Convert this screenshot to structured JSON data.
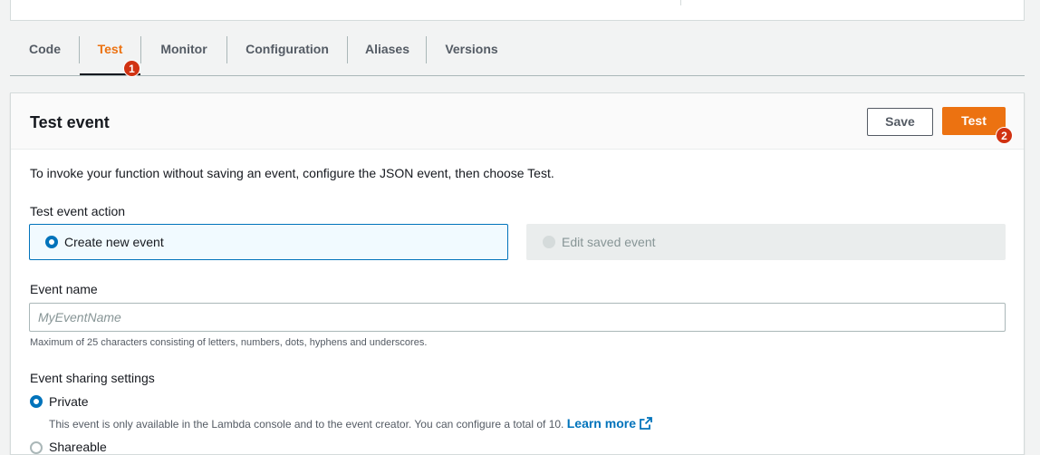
{
  "tabs": [
    {
      "label": "Code",
      "active": false
    },
    {
      "label": "Test",
      "active": true
    },
    {
      "label": "Monitor",
      "active": false
    },
    {
      "label": "Configuration",
      "active": false
    },
    {
      "label": "Aliases",
      "active": false
    },
    {
      "label": "Versions",
      "active": false
    }
  ],
  "annotations": {
    "badge1": "1",
    "badge2": "2"
  },
  "panel": {
    "title": "Test event",
    "save_label": "Save",
    "test_label": "Test",
    "intro": "To invoke your function without saving an event, configure the JSON event, then choose Test."
  },
  "test_event_action": {
    "label": "Test event action",
    "options": [
      {
        "label": "Create new event",
        "selected": true,
        "disabled": false
      },
      {
        "label": "Edit saved event",
        "selected": false,
        "disabled": true
      }
    ]
  },
  "event_name": {
    "label": "Event name",
    "value": "",
    "placeholder": "MyEventName",
    "hint": "Maximum of 25 characters consisting of letters, numbers, dots, hyphens and underscores."
  },
  "sharing": {
    "label": "Event sharing settings",
    "private_label": "Private",
    "private_selected": true,
    "private_desc": "This event is only available in the Lambda console and to the event creator. You can configure a total of 10.",
    "learn_more": "Learn more",
    "shareable_label": "Shareable"
  },
  "colors": {
    "accent": "#ec7211",
    "link": "#0073bb",
    "badge": "#d13212"
  },
  "icons": {
    "external_link": "external-link-icon"
  }
}
